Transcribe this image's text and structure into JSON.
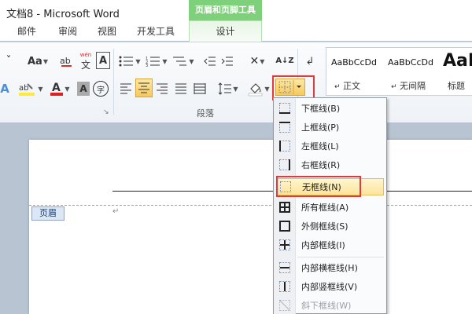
{
  "window": {
    "title": "文档8 - Microsoft Word"
  },
  "contextual_tab_header": "页眉和页脚工具",
  "tabs": [
    {
      "label": "邮件"
    },
    {
      "label": "审阅"
    },
    {
      "label": "视图"
    },
    {
      "label": "开发工具"
    },
    {
      "label": "设计"
    }
  ],
  "ribbon": {
    "font_case_label": "Aa",
    "font_color_label": "A",
    "char_shading_label": "A",
    "enclose_char_label": "字",
    "phonetic_label": "wén",
    "phonetic_glyph": "文",
    "sort_label": "A↓Z",
    "paragraph_group_label": "段落",
    "styles": [
      {
        "sample": "AaBbCcDd",
        "name": "正文"
      },
      {
        "sample": "AaBbCcDd",
        "name": "无间隔"
      },
      {
        "sample": "AaI",
        "name": "标题"
      }
    ]
  },
  "document": {
    "header_tag": "页眉",
    "paragraph_mark": "↵"
  },
  "borders_menu": {
    "items": [
      {
        "label": "下框线(B)",
        "icon": "bottom-border-icon"
      },
      {
        "label": "上框线(P)",
        "icon": "top-border-icon"
      },
      {
        "label": "左框线(L)",
        "icon": "left-border-icon"
      },
      {
        "label": "右框线(R)",
        "icon": "right-border-icon"
      },
      {
        "label": "无框线(N)",
        "icon": "no-border-icon",
        "highlighted": true
      },
      {
        "label": "所有框线(A)",
        "icon": "all-borders-icon"
      },
      {
        "label": "外侧框线(S)",
        "icon": "outside-borders-icon"
      },
      {
        "label": "内部框线(I)",
        "icon": "inside-borders-icon"
      },
      {
        "label": "内部横框线(H)",
        "icon": "inside-horizontal-border-icon"
      },
      {
        "label": "内部竖框线(V)",
        "icon": "inside-vertical-border-icon"
      },
      {
        "label": "斜下框线(W)",
        "icon": "diagonal-down-border-icon",
        "disabled": true
      }
    ]
  },
  "colors": {
    "contextual_green": "#7fd07a",
    "highlight_red": "#e23a3a",
    "menu_hover": "#fde49a"
  }
}
